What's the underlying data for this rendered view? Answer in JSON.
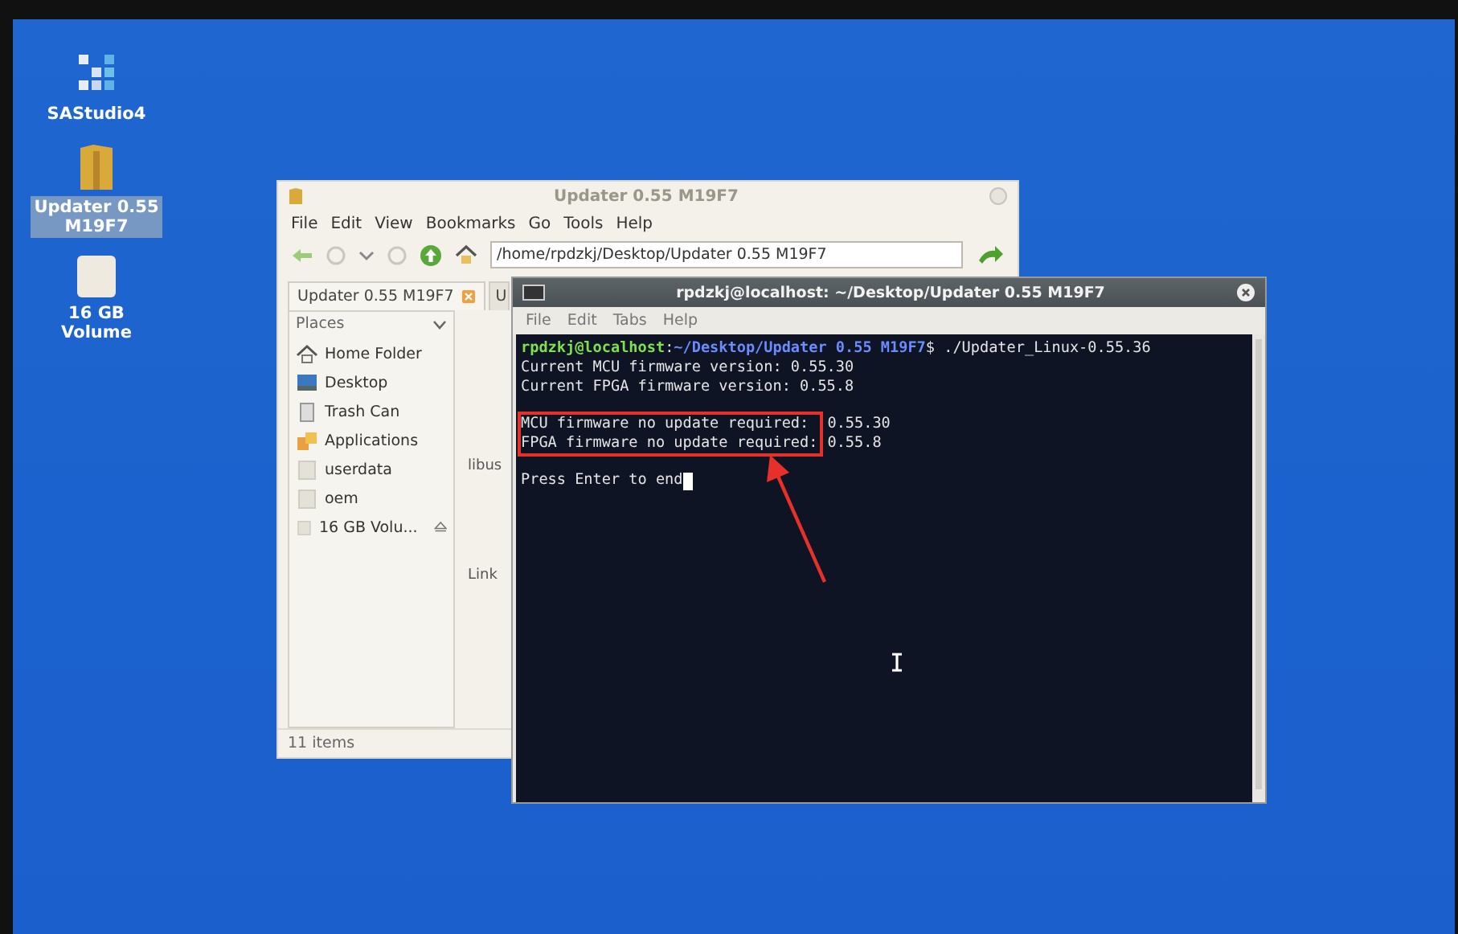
{
  "desktop_icons": [
    {
      "label": "SAStudio4",
      "kind": "app",
      "selected": false
    },
    {
      "label": "Updater 0.55 M19F7",
      "kind": "folder",
      "selected": true
    },
    {
      "label": "16 GB Volume",
      "kind": "drive",
      "selected": false
    }
  ],
  "file_manager": {
    "title": "Updater 0.55 M19F7",
    "menu": [
      "File",
      "Edit",
      "View",
      "Bookmarks",
      "Go",
      "Tools",
      "Help"
    ],
    "address": "/home/rpdzkj/Desktop/Updater 0.55 M19F7",
    "tabs": [
      {
        "label": "Updater 0.55 M19F7",
        "selected": true
      },
      {
        "label": "U",
        "selected": false
      }
    ],
    "sidebar": {
      "header": "Places",
      "items": [
        {
          "label": "Home Folder",
          "kind": "home",
          "eject": false
        },
        {
          "label": "Desktop",
          "kind": "desktop",
          "eject": false
        },
        {
          "label": "Trash Can",
          "kind": "trash",
          "eject": false
        },
        {
          "label": "Applications",
          "kind": "apps",
          "eject": false
        },
        {
          "label": "userdata",
          "kind": "volume",
          "eject": false
        },
        {
          "label": "oem",
          "kind": "volume",
          "eject": false
        },
        {
          "label": "16 GB Volu...",
          "kind": "volume",
          "eject": true
        }
      ]
    },
    "files": [
      "libus",
      "Link"
    ],
    "status": "11 items"
  },
  "terminal": {
    "title": "rpdzkj@localhost: ~/Desktop/Updater 0.55 M19F7",
    "menu": [
      "File",
      "Edit",
      "Tabs",
      "Help"
    ],
    "prompt": {
      "user": "rpdzkj@localhost",
      "separator": ":",
      "path": "~/Desktop/Updater 0.55 M19F7",
      "command": "$ ./Updater_Linux-0.55.36"
    },
    "output": [
      "Current MCU firmware version: 0.55.30",
      "Current FPGA firmware version: 0.55.8"
    ],
    "results": {
      "highlighted": true,
      "items": [
        {
          "label": "MCU firmware no update required:",
          "value": "0.55.30"
        },
        {
          "label": "FPGA firmware no update required:",
          "value": "0.55.8"
        }
      ]
    },
    "input_line": {
      "text": "Press Enter to end",
      "cursor": true
    }
  }
}
